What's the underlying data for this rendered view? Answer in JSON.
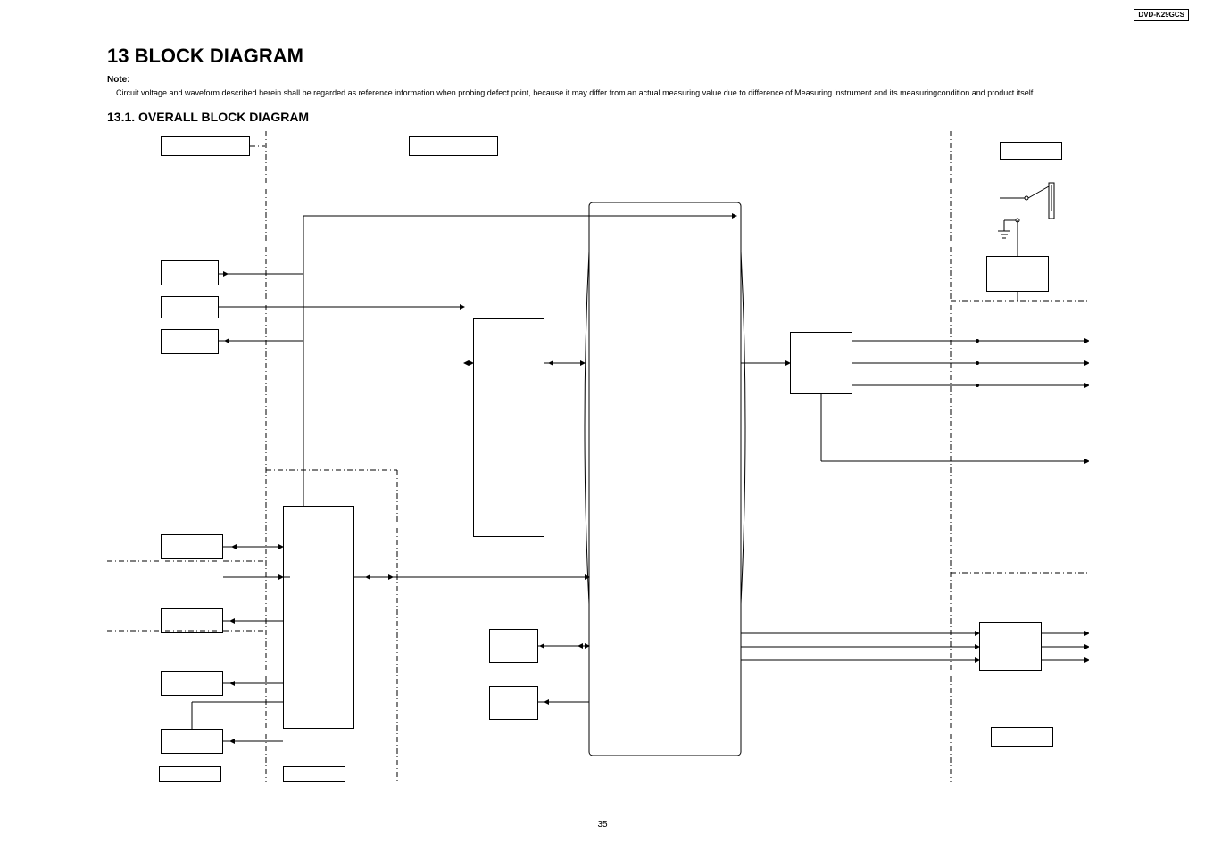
{
  "model": "DVD-K29GCS",
  "heading_main": "13 BLOCK DIAGRAM",
  "note_label": "Note:",
  "note_text": "Circuit voltage and waveform described herein shall be regarded as reference information when probing defect point, because it may differ from an actual measuring value due to difference of Measuring instrument and its measuringcondition and product itself.",
  "heading_sub": "13.1.  OVERALL BLOCK DIAGRAM",
  "page_number": "35"
}
